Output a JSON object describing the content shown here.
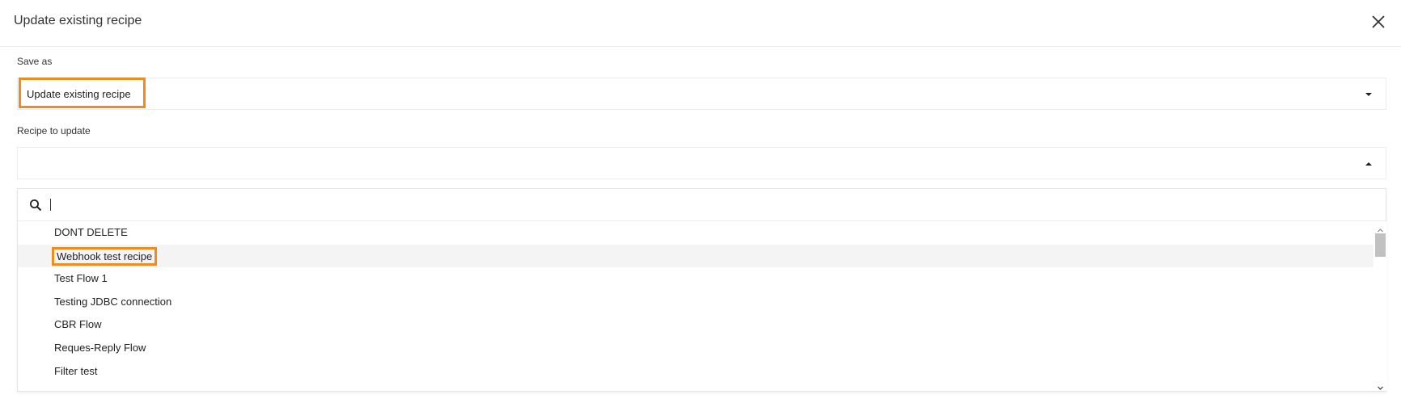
{
  "dialog": {
    "title": "Update existing recipe",
    "close_icon": "close-icon"
  },
  "save_as": {
    "label": "Save as",
    "value": "Update existing recipe",
    "caret_icon": "caret-down-icon"
  },
  "recipe_to_update": {
    "label": "Recipe to update",
    "value": "",
    "caret_icon": "caret-up-icon",
    "search": {
      "icon": "search-icon",
      "value": "",
      "placeholder": ""
    },
    "options": [
      "DONT DELETE",
      "Webhook test recipe",
      "Test Flow 1",
      "Testing JDBC connection",
      "CBR Flow",
      "Reques-Reply Flow",
      "Filter test"
    ],
    "hovered_option": "Webhook test recipe"
  },
  "colors": {
    "highlight": "#f08c1e",
    "hover_row": "#f4f4f4",
    "border": "#ececec",
    "scroll_thumb": "#c1c1c1"
  }
}
